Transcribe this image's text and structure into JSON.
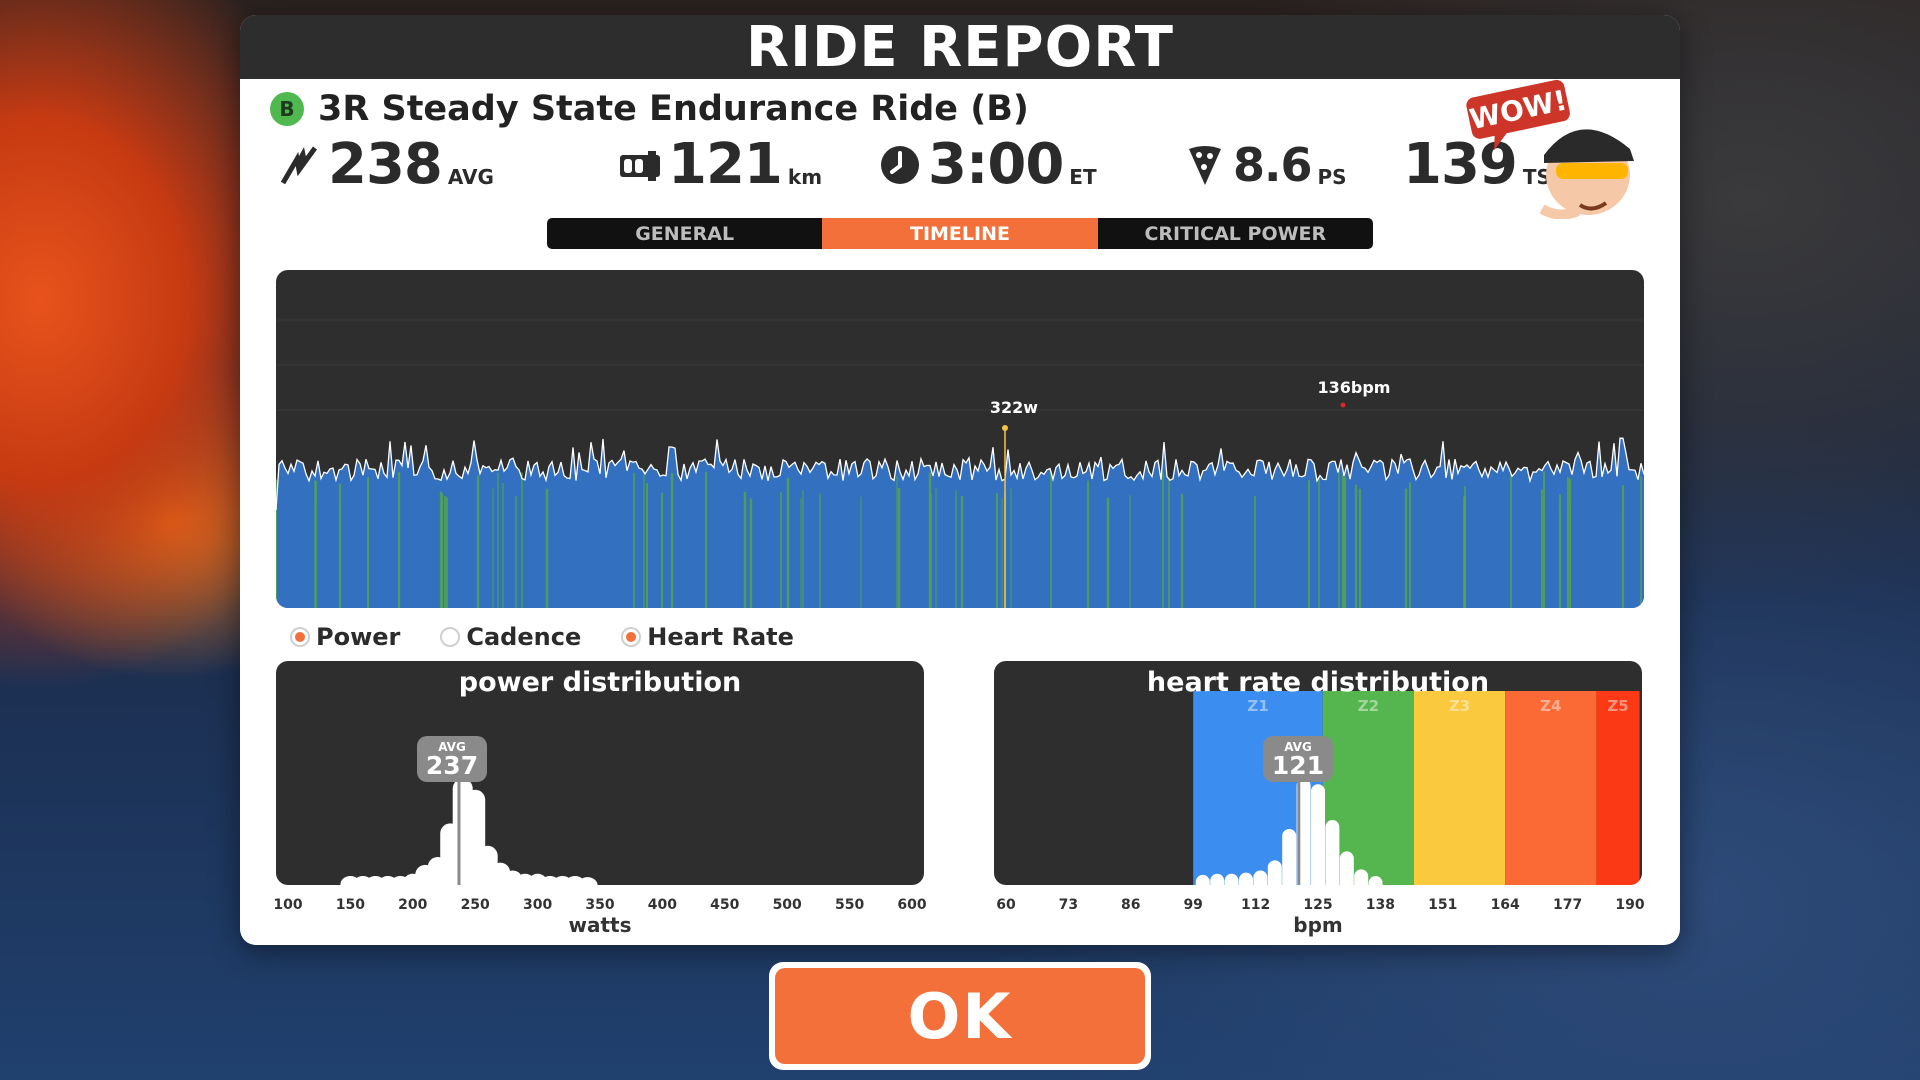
{
  "window": {
    "title": "RIDE REPORT"
  },
  "ride": {
    "badge": "B",
    "name": "3R Steady State Endurance Ride (B)"
  },
  "stats": {
    "power": {
      "value": "238",
      "unit": "AVG",
      "icon": "lightning-icon"
    },
    "distance": {
      "value": "121",
      "unit": "km",
      "icon": "odometer-icon"
    },
    "time": {
      "value": "3:00",
      "unit": "ET",
      "icon": "clock-icon"
    },
    "pizza": {
      "value": "8.6",
      "unit": "PS",
      "icon": "pizza-slice-icon"
    },
    "tss": {
      "value": "139",
      "unit": "TSS"
    }
  },
  "mascot": {
    "bubble_text": "WOW!"
  },
  "tabs": [
    {
      "label": "GENERAL",
      "active": false
    },
    {
      "label": "TIMELINE",
      "active": true
    },
    {
      "label": "CRITICAL POWER",
      "active": false
    }
  ],
  "timeline": {
    "power_peak_label": "322w",
    "hr_peak_label": "136bpm",
    "colors": {
      "power_fill": "#3470c0",
      "hr_line": "#d8262c",
      "power_line": "#ffffff",
      "zone_green": "#55a845",
      "peak_marker": "#f5c242"
    }
  },
  "legend": [
    {
      "label": "Power",
      "checked": true
    },
    {
      "label": "Cadence",
      "checked": false
    },
    {
      "label": "Heart Rate",
      "checked": true
    }
  ],
  "power_distribution": {
    "title": "power distribution",
    "avg_label": "AVG",
    "avg_value": "237",
    "ticks": [
      "100",
      "150",
      "200",
      "250",
      "300",
      "350",
      "400",
      "450",
      "500",
      "550",
      "600"
    ],
    "axis_label": "watts",
    "chart_data": {
      "type": "bar",
      "x": [
        150,
        160,
        170,
        180,
        190,
        200,
        210,
        220,
        230,
        240,
        250,
        260,
        270,
        280,
        290,
        300,
        310,
        320,
        330,
        340
      ],
      "values": [
        0.08,
        0.08,
        0.08,
        0.08,
        0.08,
        0.1,
        0.18,
        0.25,
        0.55,
        0.95,
        0.85,
        0.35,
        0.2,
        0.13,
        0.1,
        0.1,
        0.08,
        0.08,
        0.08,
        0.07
      ],
      "xlim": [
        100,
        600
      ]
    }
  },
  "hr_distribution": {
    "title": "heart rate distribution",
    "avg_label": "AVG",
    "avg_value": "121",
    "ticks": [
      "60",
      "73",
      "86",
      "99",
      "112",
      "125",
      "138",
      "151",
      "164",
      "177",
      "190"
    ],
    "axis_label": "bpm",
    "zones": [
      {
        "label": "Z1",
        "from": 99,
        "to": 126,
        "color": "#3b8ef0"
      },
      {
        "label": "Z2",
        "from": 126,
        "to": 145,
        "color": "#55b54e"
      },
      {
        "label": "Z3",
        "from": 145,
        "to": 164,
        "color": "#fac93e"
      },
      {
        "label": "Z4",
        "from": 164,
        "to": 183,
        "color": "#fb6a35"
      },
      {
        "label": "Z5",
        "from": 183,
        "to": 192,
        "color": "#fb3914"
      }
    ],
    "chart_data": {
      "type": "bar",
      "x": [
        101,
        104,
        107,
        110,
        113,
        116,
        119,
        122,
        125,
        128,
        131,
        134,
        137
      ],
      "values": [
        0.09,
        0.1,
        0.1,
        0.11,
        0.13,
        0.22,
        0.5,
        0.95,
        0.9,
        0.58,
        0.3,
        0.14,
        0.08
      ],
      "xlim": [
        60,
        190
      ]
    }
  },
  "ok_button": {
    "label": "OK"
  }
}
